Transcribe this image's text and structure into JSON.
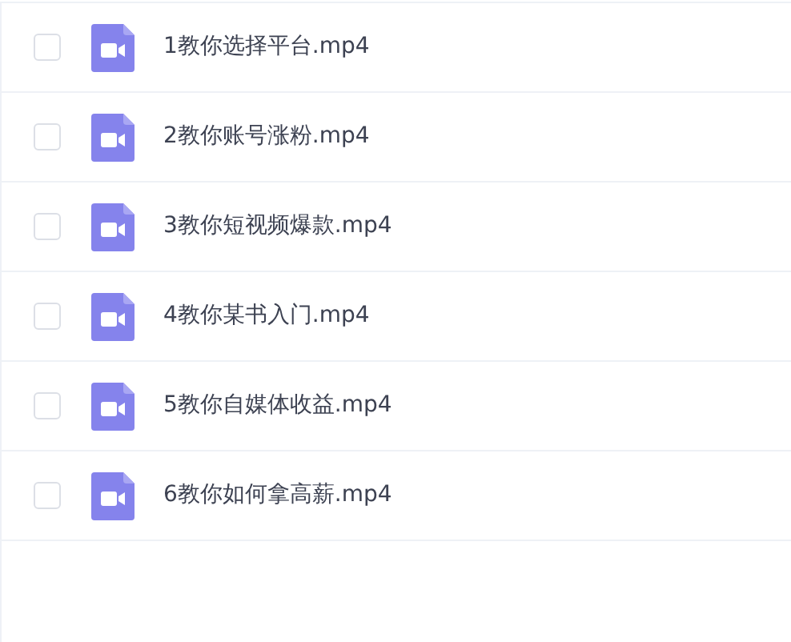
{
  "files": [
    {
      "name": "1教你选择平台.mp4",
      "checked": false
    },
    {
      "name": "2教你账号涨粉.mp4",
      "checked": false
    },
    {
      "name": "3教你短视频爆款.mp4",
      "checked": false
    },
    {
      "name": "4教你某书入门.mp4",
      "checked": false
    },
    {
      "name": "5教你自媒体收益.mp4",
      "checked": false
    },
    {
      "name": "6教你如何拿高薪.mp4",
      "checked": false
    }
  ]
}
